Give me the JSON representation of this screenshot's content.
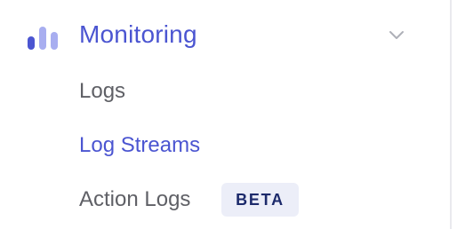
{
  "theme": {
    "accent": "#4b55d1",
    "bar_dark": "#4b55d1",
    "bar_light": "#a8aef0",
    "text_muted": "#5f6066",
    "chevron": "#aeb0b8",
    "badge_bg": "#eceef8",
    "badge_text": "#1c2a6b",
    "divider": "#e9e9ee"
  },
  "section": {
    "title": "Monitoring",
    "icon": "bar-chart-icon",
    "toggle_icon": "chevron-down-icon"
  },
  "items": [
    {
      "label": "Logs",
      "active": false
    },
    {
      "label": "Log Streams",
      "active": true
    },
    {
      "label": "Action Logs",
      "active": false,
      "badge": "BETA"
    }
  ]
}
